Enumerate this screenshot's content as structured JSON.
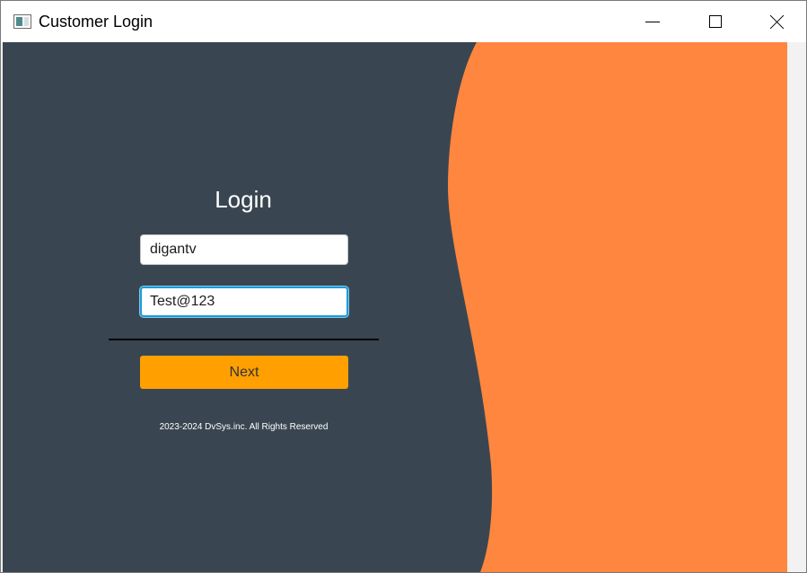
{
  "window": {
    "title": "Customer Login",
    "controls": {
      "minimize": "minimize",
      "maximize": "maximize",
      "close": "close"
    }
  },
  "login": {
    "heading": "Login",
    "username_value": "digantv",
    "password_value": "Test@123",
    "next_label": "Next",
    "footer": "2023-2024 DvSys.inc. All Rights Reserved"
  },
  "colors": {
    "panel": "#394651",
    "accent_shape": "#ff863e",
    "button": "#ff9f00",
    "focus_border": "#1d9bd8"
  },
  "icons": {
    "app": "app-window-icon",
    "minimize": "minimize-icon",
    "maximize": "maximize-icon",
    "close": "close-icon"
  }
}
